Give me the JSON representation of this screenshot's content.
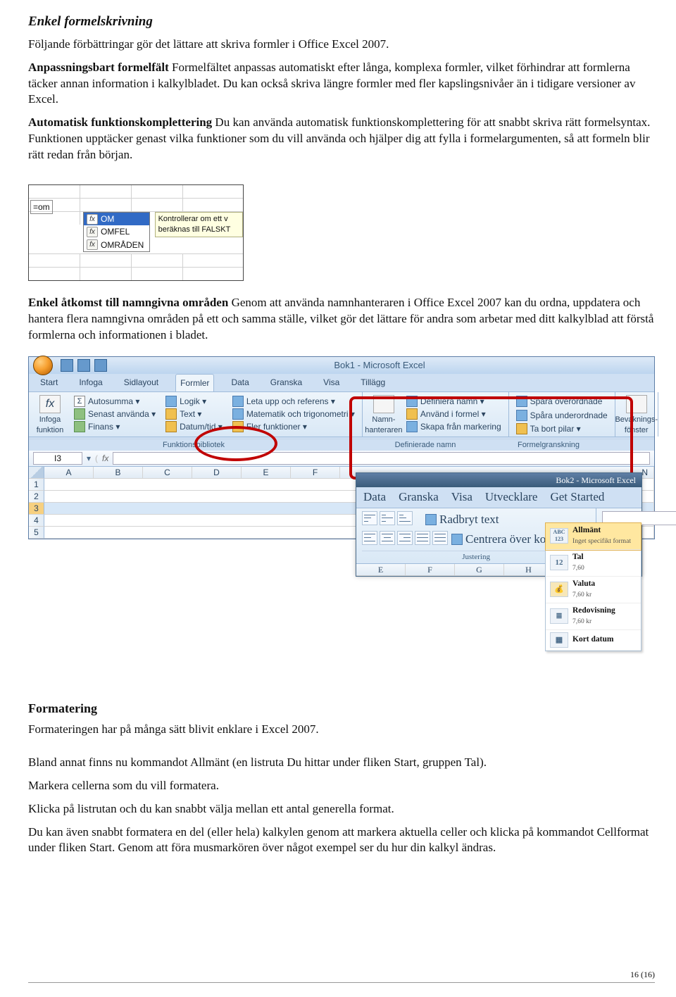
{
  "section1": {
    "title": "Enkel formelskrivning",
    "intro": "Följande förbättringar gör det lättare att skriva formler i Office Excel 2007.",
    "p1_bold": "Anpassningsbart formelfält",
    "p1_rest": " Formelfältet anpassas automatiskt efter långa, komplexa formler, vilket förhindrar att formlerna täcker annan information i kalkylbladet. Du kan också skriva längre formler med fler kapslingsnivåer än i tidigare versioner av Excel.",
    "p2_bold": "Automatisk funktionskomplettering",
    "p2_rest": "   Du kan använda automatisk funktionskomplettering för att snabbt skriva rätt formelsyntax. Funktionen upptäcker genast vilka funktioner som du vill använda och hjälper dig att fylla i formelargumenten, så att formeln blir rätt redan från början."
  },
  "autocomplete": {
    "typed": "=om",
    "items": [
      "OM",
      "OMFEL",
      "OMRÅDEN"
    ],
    "tooltip": "Kontrollerar om ett v beräknas till FALSKT"
  },
  "section2": {
    "p_bold": "Enkel åtkomst till namngivna områden",
    "p_rest": "   Genom att använda namnhanteraren i Office Excel 2007 kan du ordna, uppdatera och hantera flera namngivna områden på ett och samma ställe, vilket gör det lättare för andra som arbetar med ditt kalkylblad att förstå formlerna och informationen i bladet."
  },
  "ribbon": {
    "title": "Bok1 - Microsoft Excel",
    "tabs": [
      "Start",
      "Infoga",
      "Sidlayout",
      "Formler",
      "Data",
      "Granska",
      "Visa",
      "Tillägg"
    ],
    "active_tab": "Formler",
    "group1": {
      "big": "Infoga funktion",
      "btns": [
        "Autosumma ▾",
        "Senast använda ▾",
        "Finans ▾"
      ],
      "btns2": [
        "Logik ▾",
        "Text ▾",
        "Datum/tid ▾"
      ],
      "btns3": [
        "Leta upp och referens ▾",
        "Matematik och trigonometri ▾",
        "Fler funktioner ▾"
      ],
      "title": "Funktionsbibliotek"
    },
    "group2": {
      "big": "Namn-hanteraren",
      "btns": [
        "Definiera namn ▾",
        "Använd i formel ▾",
        "Skapa från markering"
      ],
      "title": "Definierade namn"
    },
    "group3": {
      "btns": [
        "Spåra överordnade",
        "Spåra underordnade",
        "Ta bort pilar ▾"
      ],
      "title": "Formelgranskning"
    },
    "group4": {
      "big": "Bevaknings-fönster"
    },
    "cellref": "I3",
    "cols": [
      "A",
      "B",
      "C",
      "D",
      "E",
      "F"
    ],
    "cols_right": "N",
    "rows": [
      "1",
      "2",
      "3",
      "4",
      "5"
    ]
  },
  "overlay": {
    "title": "Bok2 - Microsoft Excel",
    "tabs": [
      "Data",
      "Granska",
      "Visa",
      "Utvecklare",
      "Get Started"
    ],
    "just_btns": [
      "Radbryt text",
      "Centrera över kolumner ▾"
    ],
    "just_title": "Justering",
    "cols": [
      "E",
      "F",
      "G",
      "H"
    ],
    "num_panel": [
      {
        "icon": "ABC 123",
        "title": "Allmänt",
        "sub": "Inget specifikt format",
        "sel": true
      },
      {
        "icon": "12",
        "title": "Tal",
        "sub": "7,60"
      },
      {
        "icon": "kr",
        "title": "Valuta",
        "sub": "7,60 kr"
      },
      {
        "icon": "≣",
        "title": "Redovisning",
        "sub": "7,60 kr"
      },
      {
        "icon": "▦",
        "title": "Kort datum",
        "sub": ""
      }
    ]
  },
  "section3": {
    "title": "Formatering",
    "p1": "Formateringen har på många sätt blivit enklare i Excel 2007.",
    "p2": "Bland annat finns nu kommandot Allmänt (en listruta Du hittar under fliken Start, gruppen Tal).",
    "p3": "Markera cellerna som du vill formatera.",
    "p4": "Klicka på listrutan och du kan snabbt välja mellan ett antal generella format.",
    "p5": "Du kan även snabbt formatera en del (eller hela) kalkylen genom att markera aktuella celler och klicka på kommandot Cellformat under fliken Start. Genom att föra musmarkören över något exempel ser du hur din kalkyl ändras."
  },
  "footer": "16 (16)"
}
